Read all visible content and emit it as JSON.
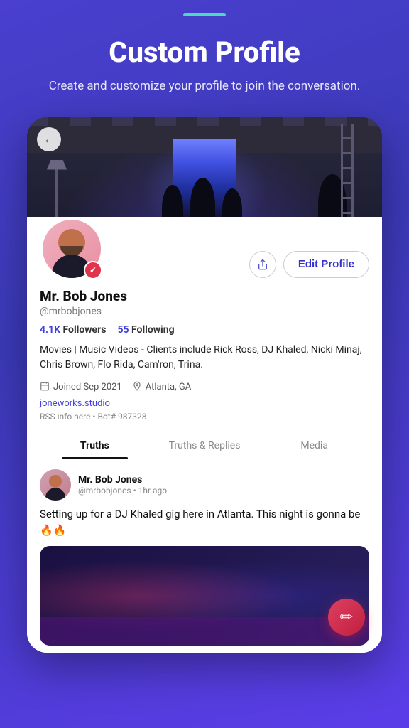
{
  "topbar": {
    "accent_line": "top accent line"
  },
  "hero": {
    "title": "Custom Profile",
    "subtitle": "Create and customize your profile to join the conversation."
  },
  "profile": {
    "name": "Mr. Bob Jones",
    "handle": "@mrbobjones",
    "followers_count": "4.1K",
    "followers_label": "Followers",
    "following_count": "55",
    "following_label": "Following",
    "bio": "Movies | Music Videos - Clients include Rick Ross, DJ Khaled, Nicki Minaj, Chris Brown, Flo Rida, Cam'ron, Trina.",
    "joined": "Joined Sep 2021",
    "location": "Atlanta, GA",
    "website": "joneworks.studio",
    "rss_info": "RSS info here • Bot# 987328",
    "edit_profile_label": "Edit Profile",
    "share_label": "Share"
  },
  "tabs": [
    {
      "label": "Truths",
      "active": true
    },
    {
      "label": "Truths & Replies",
      "active": false
    },
    {
      "label": "Media",
      "active": false
    }
  ],
  "post": {
    "author_name": "Mr. Bob Jones",
    "author_handle": "@mrbobjones",
    "time_ago": "1hr ago",
    "text": "Setting up for a DJ Khaled gig here in Atlanta. This night is gonna be 🔥🔥",
    "separator": "•"
  },
  "fab": {
    "icon": "✏",
    "label": "Compose"
  },
  "back_button": {
    "icon": "←"
  }
}
